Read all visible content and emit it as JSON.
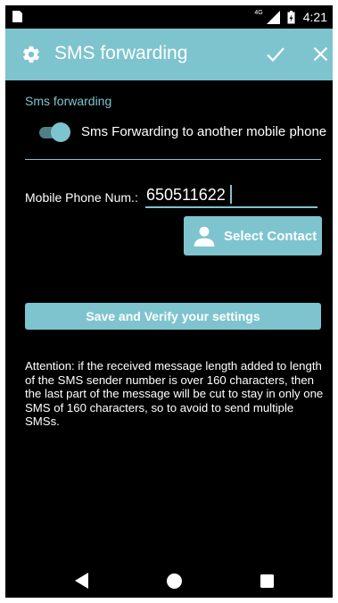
{
  "status_bar": {
    "network_type": "4G",
    "time": "4:21",
    "icons": [
      "sim-card-icon",
      "signal-icon",
      "battery-icon"
    ]
  },
  "action_bar": {
    "title": "SMS forwarding",
    "icons": [
      "gear-icon",
      "check-icon",
      "close-icon"
    ]
  },
  "settings": {
    "section_header": "Sms forwarding",
    "switch_label": "Sms Forwarding to another mobile phone",
    "switch_on": true,
    "phone_label": "Mobile Phone Num.:",
    "phone_value": "650511622",
    "select_contact_label": "Select Contact",
    "save_label": "Save and Verify your settings",
    "attention_text": "Attention: if the received message length added to length of the SMS sender number is over 160 characters, then the last part of the message will be cut to stay in only one SMS of 160 characters, so to avoid to send multiple SMSs."
  },
  "nav_bar": {
    "icons": [
      "back-icon",
      "home-icon",
      "recents-icon"
    ]
  },
  "colors": {
    "accent": "#7ec4cf",
    "background": "#000000",
    "text": "#ffffff"
  }
}
